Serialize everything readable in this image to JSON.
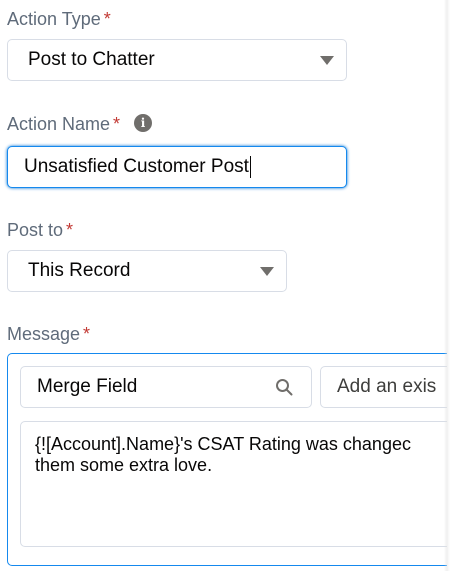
{
  "action_type": {
    "label": "Action Type",
    "required_marker": "*",
    "value": "Post to Chatter"
  },
  "action_name": {
    "label": "Action Name",
    "required_marker": "*",
    "info_glyph": "i",
    "value": "Unsatisfied Customer Post"
  },
  "post_to": {
    "label": "Post to",
    "required_marker": "*",
    "value": "This Record"
  },
  "message": {
    "label": "Message",
    "required_marker": "*",
    "merge_field_label": "Merge Field",
    "existing_placeholder": "Add an exis",
    "body": "{![Account].Name}'s CSAT Rating was changec\nthem some extra love."
  },
  "icons": {
    "select_caret": "chevron-down-icon",
    "info": "info-icon",
    "search": "search-icon"
  },
  "colors": {
    "focus_border": "#1589ee",
    "required": "#c23934",
    "label": "#5f6b7a"
  }
}
